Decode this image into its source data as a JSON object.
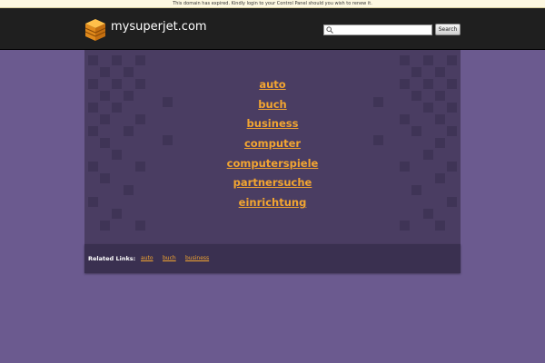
{
  "notice": "This domain has expired. Kindly login to your Control Panel should you wish to renew it.",
  "header": {
    "logo_text": "mysuperjet.com",
    "search_placeholder": "",
    "search_button": "Search"
  },
  "main_links": [
    "auto",
    "buch",
    "business",
    "computer",
    "computerspiele",
    "partnersuche",
    "einrichtung"
  ],
  "related": {
    "title": "Related Links:",
    "links": [
      "auto",
      "buch",
      "business"
    ]
  },
  "colors": {
    "page_bg": "#6b5a8f",
    "header_bg": "#1f1f1f",
    "panel_bg": "#4a3d62",
    "link": "#f2a531"
  }
}
